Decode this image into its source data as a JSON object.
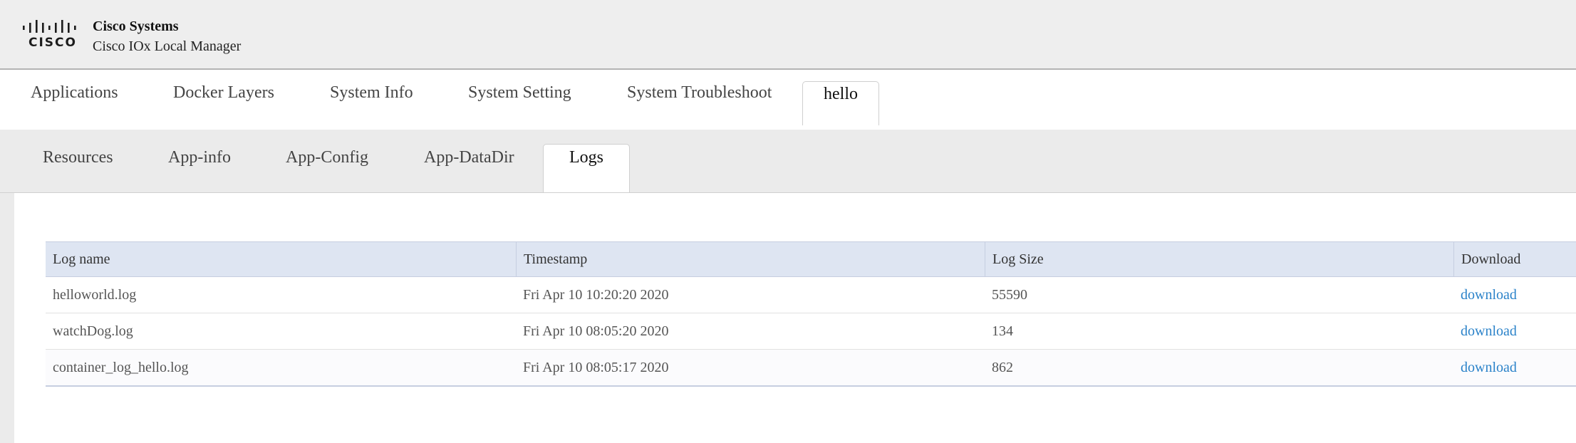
{
  "brand": {
    "logo_text": "CISCO",
    "company": "Cisco Systems",
    "product": "Cisco IOx Local Manager"
  },
  "main_tabs": [
    {
      "label": "Applications"
    },
    {
      "label": "Docker Layers"
    },
    {
      "label": "System Info"
    },
    {
      "label": "System Setting"
    },
    {
      "label": "System Troubleshoot"
    },
    {
      "label": "hello",
      "active": true
    }
  ],
  "sub_tabs": [
    {
      "label": "Resources"
    },
    {
      "label": "App-info"
    },
    {
      "label": "App-Config"
    },
    {
      "label": "App-DataDir"
    },
    {
      "label": "Logs",
      "active": true
    }
  ],
  "logs_table": {
    "columns": [
      "Log name",
      "Timestamp",
      "Log Size",
      "Download"
    ],
    "rows": [
      {
        "name": "helloworld.log",
        "timestamp": "Fri Apr 10 10:20:20 2020",
        "size": "55590",
        "download": "download"
      },
      {
        "name": "watchDog.log",
        "timestamp": "Fri Apr 10 08:05:20 2020",
        "size": "134",
        "download": "download"
      },
      {
        "name": "container_log_hello.log",
        "timestamp": "Fri Apr 10 08:05:17 2020",
        "size": "862",
        "download": "download"
      }
    ]
  },
  "colors": {
    "header_bg": "#eeeeee",
    "table_header_bg": "#dee5f2",
    "link": "#2a82c9"
  }
}
